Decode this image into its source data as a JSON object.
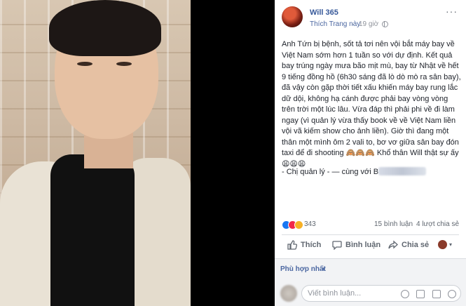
{
  "post": {
    "page_name": "Will 365",
    "like_page_label": "Thích Trang này",
    "separator": "·",
    "timestamp": "19 giờ",
    "more_label": "···",
    "body": "Anh Tứn bị bệnh, sốt tả tơi nên vội bắt máy bay về Việt Nam sớm hơn 1 tuần so với dự định. Kết quả bay trúng ngày mưa bão mịt mù, bay từ Nhật về hết 9 tiếng đồng hồ (6h30 sáng đã lò dò mò ra sân bay), đã vậy còn gặp thời tiết xấu khiến máy bay rung lắc dữ dội, không hạ cánh được phải bay vòng vòng trên trời một lúc lâu. Vừa đáp thì phải phi về đi làm ngay (vì quản lý vừa thấy book về về Việt Nam liền vội vã kiếm show cho ảnh liền). Giờ thì đang một thân một mình ôm 2 vali to, bơ vơ giữa sân bay đón taxi để đi shooting 🙈🙈🙈 Khổ thân Will thật sự ấy 😩😩😩",
    "signature_prefix": "- Chị quản lý - — cùng với",
    "signature_tagged": "B"
  },
  "stats": {
    "reaction_count": "343",
    "comments": "15 bình luận",
    "shares": "4 lượt chia sẻ"
  },
  "actions": {
    "like": "Thích",
    "comment": "Bình luận",
    "share": "Chia sẻ",
    "viewer_caret": "▾"
  },
  "comments": {
    "sort_label": "Phù hợp nhất",
    "sort_caret": "▾",
    "input_placeholder": "Viết bình luận..."
  },
  "colors": {
    "link": "#365899",
    "muted": "#606770",
    "like_blue": "#1877f2",
    "love_red": "#f0284a",
    "haha_yellow": "#f7b125"
  }
}
